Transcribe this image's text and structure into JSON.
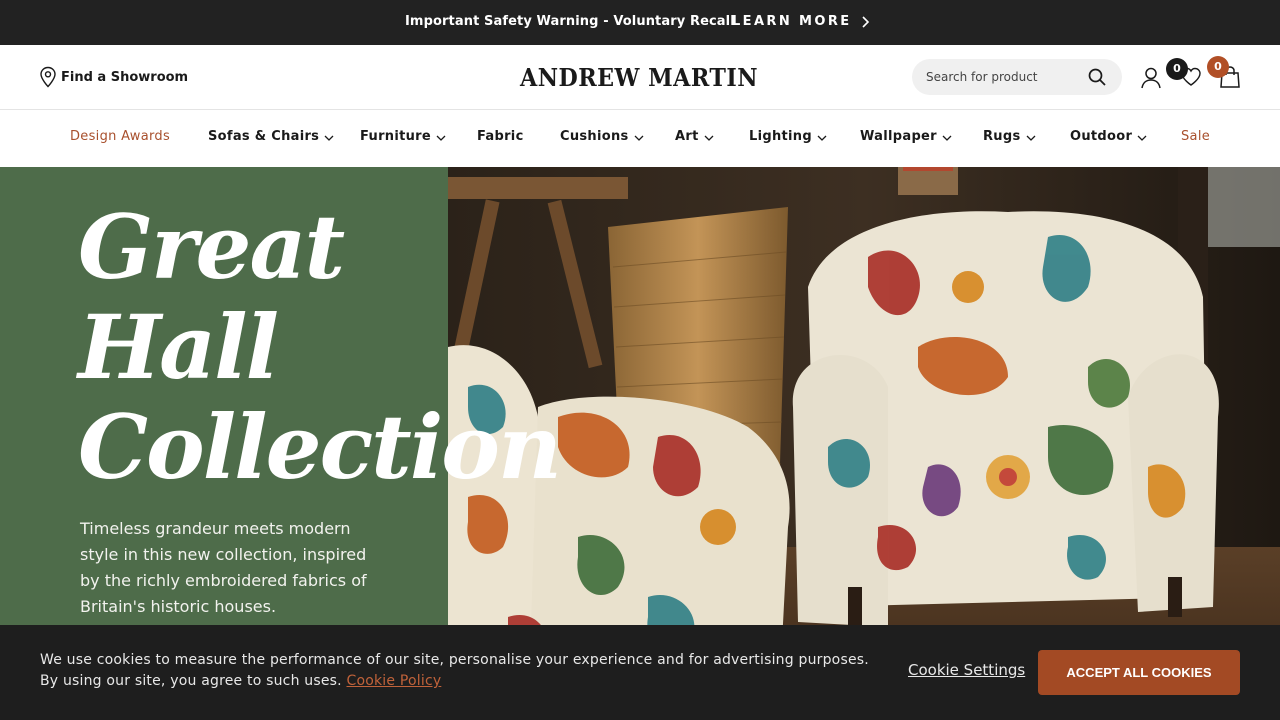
{
  "announcement": {
    "warning_text": "Important Safety Warning - Voluntary Recall",
    "cta_label": "LEARN MORE"
  },
  "header": {
    "showroom_label": "Find a Showroom",
    "logo_text": "ANDREW MARTIN",
    "search_placeholder": "Search for product",
    "wishlist_count": "0",
    "bag_count": "0"
  },
  "nav": {
    "items": [
      {
        "label": "Design Awards",
        "dropdown": false
      },
      {
        "label": "Sofas & Chairs",
        "dropdown": true
      },
      {
        "label": "Furniture",
        "dropdown": true
      },
      {
        "label": "Fabric",
        "dropdown": false
      },
      {
        "label": "Cushions",
        "dropdown": true
      },
      {
        "label": "Art",
        "dropdown": true
      },
      {
        "label": "Lighting",
        "dropdown": true
      },
      {
        "label": "Wallpaper",
        "dropdown": true
      },
      {
        "label": "Rugs",
        "dropdown": true
      },
      {
        "label": "Outdoor",
        "dropdown": true
      },
      {
        "label": "Sale",
        "dropdown": false
      }
    ]
  },
  "hero": {
    "title_lines": [
      "Great",
      "Hall",
      "Collection"
    ],
    "description": "Timeless grandeur meets modern style in this new collection, inspired by the richly embroidered fabrics of Britain's historic houses."
  },
  "cookie_banner": {
    "message": "We use cookies to measure the performance of our site, personalise your experience and for advertising purposes. By using our site, you agree to such uses.",
    "policy_link": "Cookie Policy",
    "settings_label": "Cookie Settings",
    "accept_label": "ACCEPT ALL COOKIES"
  },
  "colors": {
    "accent_rust": "#a34a24",
    "hero_green": "#4e6c4a",
    "topbar_dark": "#222222"
  }
}
